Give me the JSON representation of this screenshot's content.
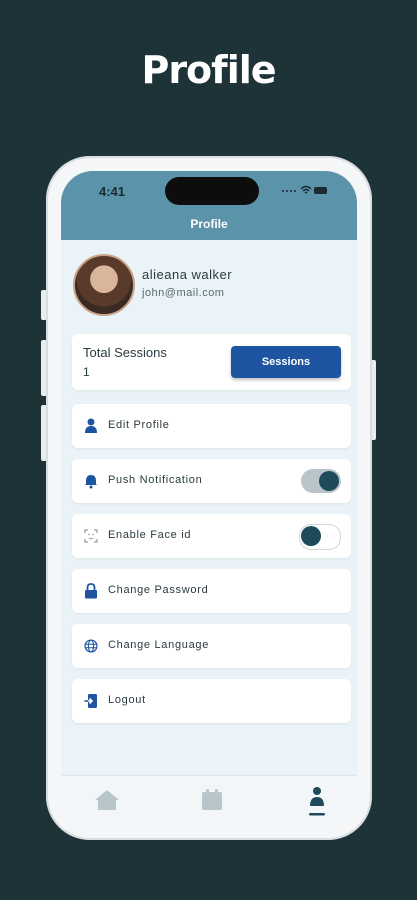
{
  "headline": "Profile",
  "status_bar": {
    "time": "4:41",
    "icons": "···  ⌔ ▭"
  },
  "screen_title": "Profile",
  "user": {
    "name": "alieana walker",
    "email": "john@mail.com"
  },
  "sessions": {
    "label": "Total Sessions",
    "count": "1",
    "button_label": "Sessions"
  },
  "menu": [
    {
      "label": "Edit Profile",
      "icon": "person-icon"
    },
    {
      "label": "Push Notification",
      "icon": "bell-icon",
      "toggle": true
    },
    {
      "label": "Enable Face id",
      "icon": "face-id-icon",
      "toggle": false
    },
    {
      "label": "Change Password",
      "icon": "lock-icon"
    },
    {
      "label": "Change Language",
      "icon": "globe-icon"
    },
    {
      "label": "Logout",
      "icon": "logout-icon"
    }
  ],
  "bottom_nav": [
    {
      "icon": "home-icon",
      "active": false
    },
    {
      "icon": "calendar-icon",
      "active": false
    },
    {
      "icon": "profile-icon",
      "active": true
    }
  ],
  "colors": {
    "background": "#1e3338",
    "header": "#5b93aa",
    "accent": "#1f55a0",
    "toggle_knob": "#1f4a5a"
  }
}
